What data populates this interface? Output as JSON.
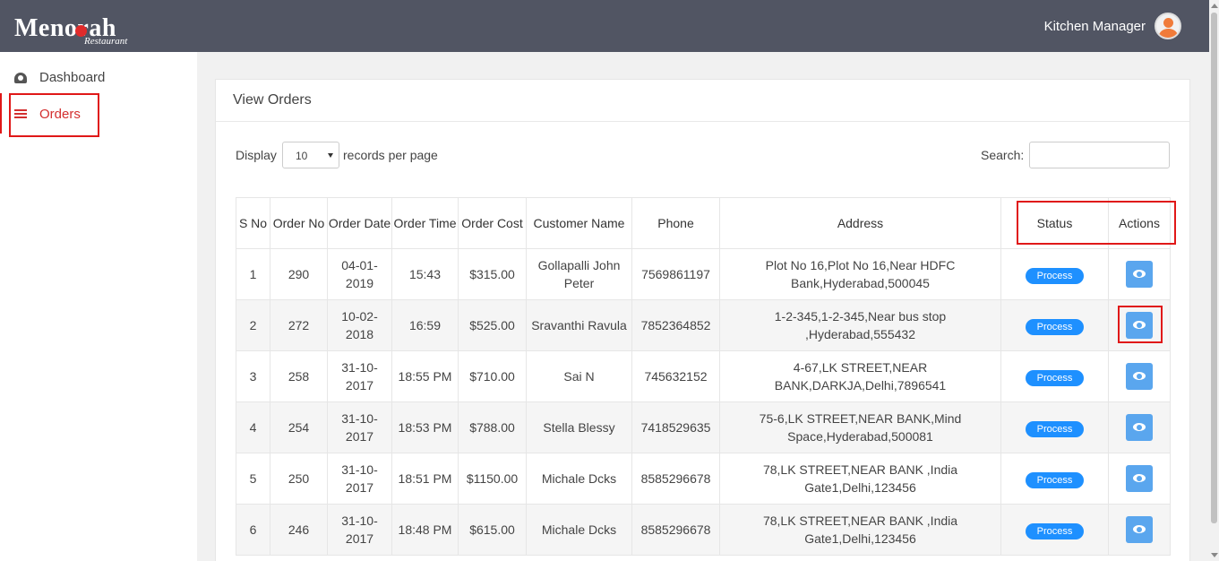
{
  "header": {
    "logo_main": "Menorah",
    "logo_sub": "Restaurant",
    "user_name": "Kitchen Manager"
  },
  "sidebar": {
    "items": [
      {
        "label": "Dashboard",
        "icon": "dashboard-icon",
        "active": false
      },
      {
        "label": "Orders",
        "icon": "list-icon",
        "active": true
      }
    ]
  },
  "main": {
    "title": "View Orders",
    "display_label": "Display",
    "page_size": "10",
    "records_label": "records per page",
    "search_label": "Search:",
    "search_value": ""
  },
  "table": {
    "headers": {
      "sno": "S No",
      "order_no": "Order No",
      "order_date": "Order Date",
      "order_time": "Order Time",
      "order_cost": "Order Cost",
      "customer": "Customer Name",
      "phone": "Phone",
      "address": "Address",
      "status": "Status",
      "actions": "Actions"
    },
    "rows": [
      {
        "sno": "1",
        "order_no": "290",
        "date": "04-01-2019",
        "time": "15:43",
        "cost": "$315.00",
        "customer": "Gollapalli John Peter",
        "phone": "7569861197",
        "address": "Plot No 16,Plot No 16,Near HDFC Bank,Hyderabad,500045",
        "status": "Process"
      },
      {
        "sno": "2",
        "order_no": "272",
        "date": "10-02-2018",
        "time": "16:59",
        "cost": "$525.00",
        "customer": "Sravanthi Ravula",
        "phone": "7852364852",
        "address": "1-2-345,1-2-345,Near bus stop ,Hyderabad,555432",
        "status": "Process"
      },
      {
        "sno": "3",
        "order_no": "258",
        "date": "31-10-2017",
        "time": "18:55 PM",
        "cost": "$710.00",
        "customer": "Sai N",
        "phone": "745632152",
        "address": "4-67,LK STREET,NEAR BANK,DARKJA,Delhi,7896541",
        "status": "Process"
      },
      {
        "sno": "4",
        "order_no": "254",
        "date": "31-10-2017",
        "time": "18:53 PM",
        "cost": "$788.00",
        "customer": "Stella Blessy",
        "phone": "7418529635",
        "address": "75-6,LK STREET,NEAR BANK,Mind Space,Hyderabad,500081",
        "status": "Process"
      },
      {
        "sno": "5",
        "order_no": "250",
        "date": "31-10-2017",
        "time": "18:51 PM",
        "cost": "$1150.00",
        "customer": "Michale Dcks",
        "phone": "8585296678",
        "address": "78,LK STREET,NEAR BANK ,India Gate1,Delhi,123456",
        "status": "Process"
      },
      {
        "sno": "6",
        "order_no": "246",
        "date": "31-10-2017",
        "time": "18:48 PM",
        "cost": "$615.00",
        "customer": "Michale Dcks",
        "phone": "8585296678",
        "address": "78,LK STREET,NEAR BANK ,India Gate1,Delhi,123456",
        "status": "Process"
      }
    ]
  },
  "colors": {
    "topbar": "#515563",
    "accent_red": "#d32f2f",
    "badge_blue": "#1e90ff",
    "view_button": "#5aa6ee",
    "highlight": "#e01818"
  }
}
